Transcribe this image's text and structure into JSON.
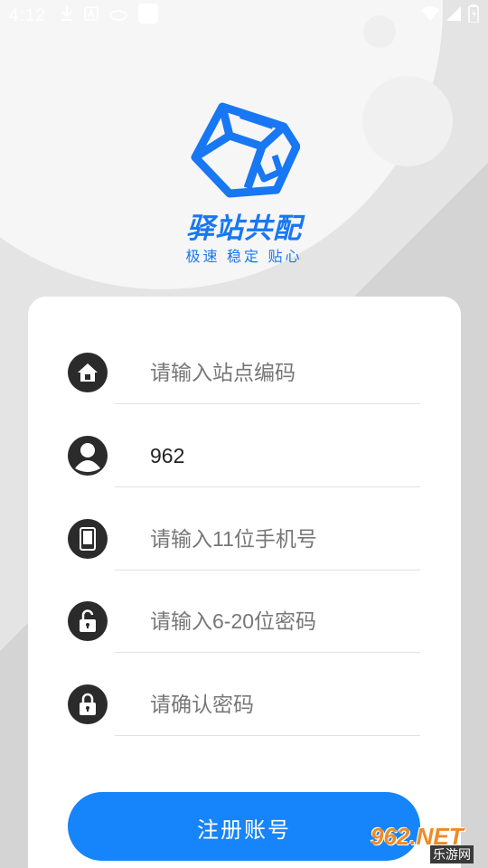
{
  "status_bar": {
    "time": "4:12",
    "icons": [
      "download-icon",
      "a-badge-icon",
      "cloud-icon",
      "square-notification-icon",
      "wifi-icon",
      "signal-icon",
      "battery-icon"
    ]
  },
  "brand": {
    "name": "驿站共配",
    "slogan": "极速 稳定 贴心",
    "color": "#1877f2"
  },
  "form": {
    "station_code": {
      "placeholder": "请输入站点编码",
      "value": ""
    },
    "username": {
      "placeholder": "",
      "value": "962"
    },
    "phone": {
      "placeholder": "请输入11位手机号",
      "value": ""
    },
    "password": {
      "placeholder": "请输入6-20位密码",
      "value": ""
    },
    "confirm_password": {
      "placeholder": "请确认密码",
      "value": ""
    }
  },
  "register_button": {
    "label": "注册账号",
    "color": "#1684fa"
  },
  "watermark": {
    "main": "962.NET",
    "sub": "乐游网"
  }
}
